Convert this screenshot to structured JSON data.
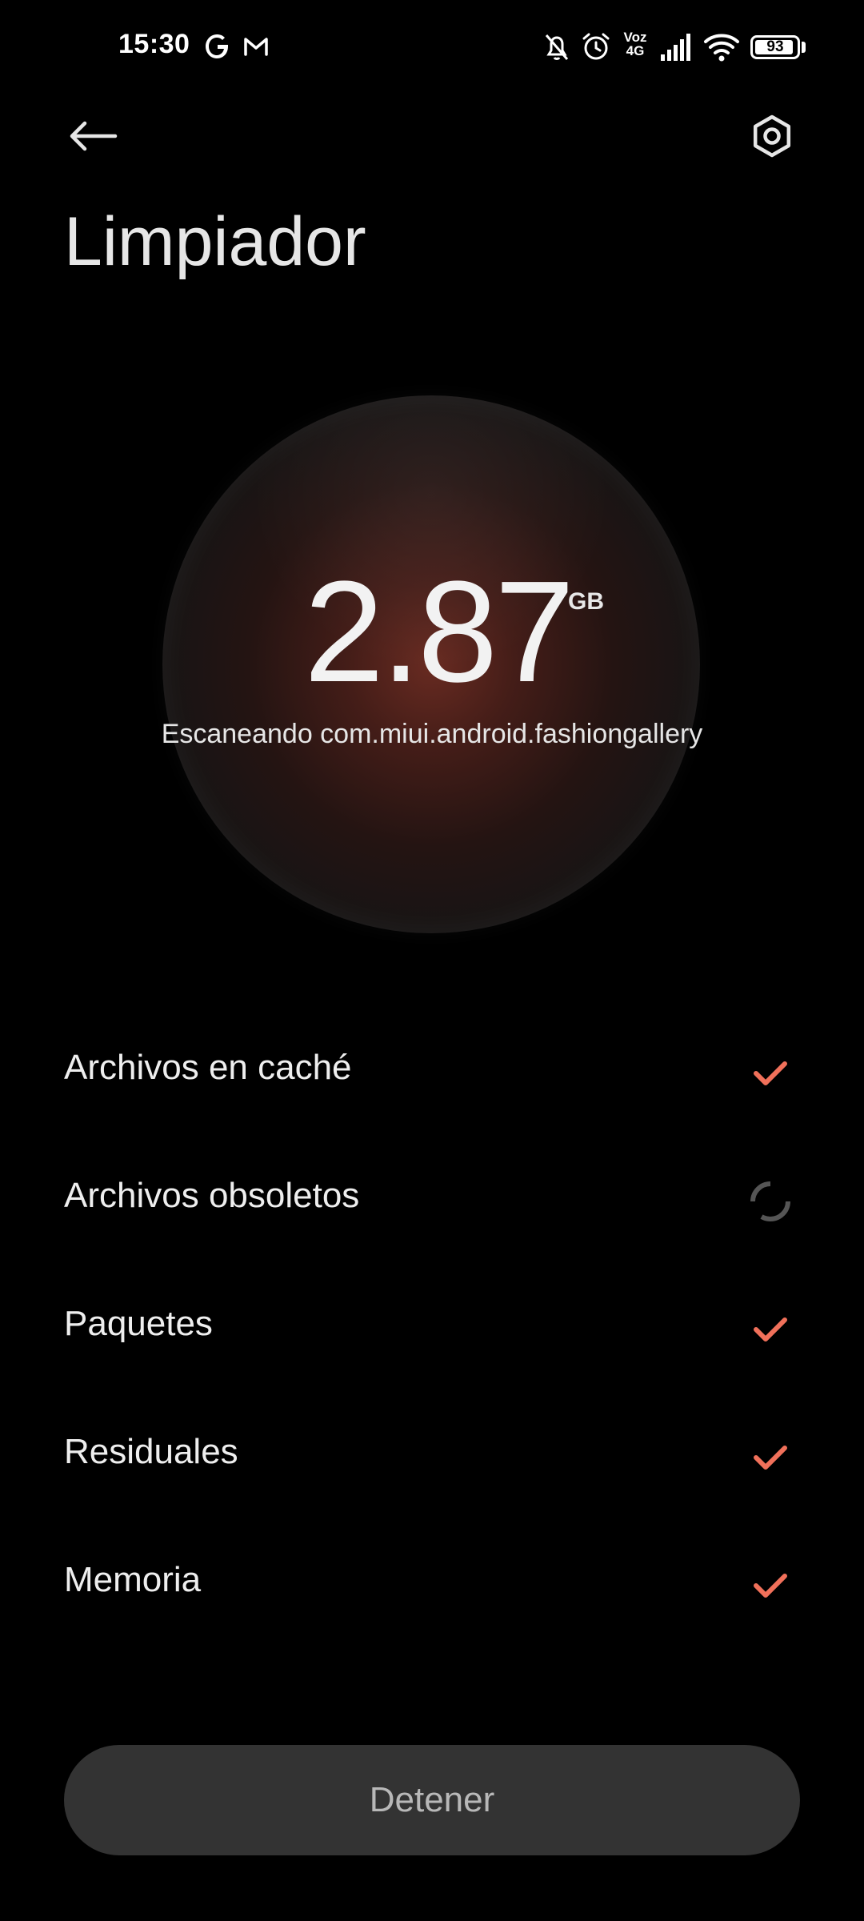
{
  "status_bar": {
    "time": "15:30",
    "left_icons": [
      "google-icon",
      "gmail-icon"
    ],
    "right_icons": [
      "notifications-off-icon",
      "alarm-icon",
      "volte-icon",
      "signal-icon",
      "wifi-icon",
      "battery-icon"
    ],
    "volte_label_top": "Voz",
    "volte_label_bottom": "4G",
    "battery_level": "93",
    "battery_fraction": 0.93
  },
  "header": {
    "back_icon": "arrow-left-icon",
    "settings_icon": "settings-hexagon-icon",
    "title": "Limpiador"
  },
  "scan": {
    "amount": "2.87",
    "unit": "GB",
    "status": "Escaneando com.miui.android.fashiongallery",
    "glow_color": "#6e2d23"
  },
  "categories": [
    {
      "label": "Archivos en caché",
      "state": "done",
      "icon": "check-icon"
    },
    {
      "label": "Archivos obsoletos",
      "state": "scanning",
      "icon": "loading-spinner-icon"
    },
    {
      "label": "Paquetes",
      "state": "done",
      "icon": "check-icon"
    },
    {
      "label": "Residuales",
      "state": "done",
      "icon": "check-icon"
    },
    {
      "label": "Memoria",
      "state": "done",
      "icon": "check-icon"
    }
  ],
  "actions": {
    "stop_label": "Detener"
  },
  "colors": {
    "background": "#000000",
    "accent_check": "#f0705a",
    "button_bg": "#333333",
    "button_text": "#b8b8b8"
  }
}
